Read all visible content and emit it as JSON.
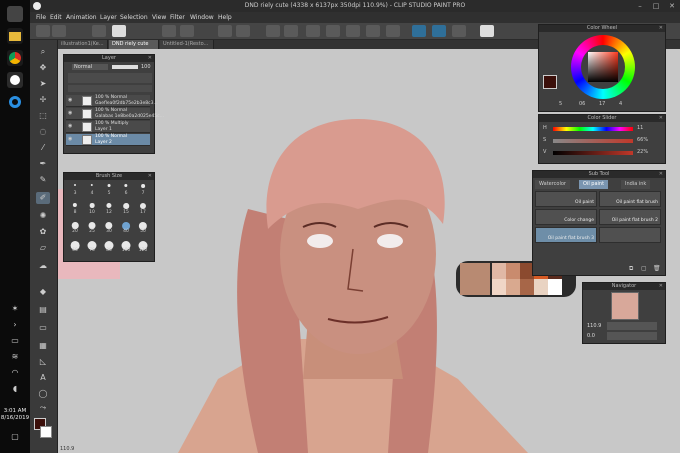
{
  "taskbar": {
    "time": "3:01 AM",
    "date": "8/16/2019"
  },
  "app": {
    "title": "DND riely cute (4338 x 6137px 350dpi 110.9%) - CLIP STUDIO PAINT PRO",
    "menu": [
      "File",
      "Edit",
      "Animation",
      "Layer",
      "Selection",
      "View",
      "Filter",
      "Window",
      "Help"
    ],
    "tabs": [
      "illustration1(Ke...",
      "DND riely cute",
      "Untitled-1(Resto..."
    ]
  },
  "layer_panel": {
    "title": "Layer",
    "blend_mode": "Normal",
    "opacity": "100",
    "layers": [
      {
        "line1": "100 % Normal",
        "line2": "Gaeflea0f2db75e2b3e8c3..."
      },
      {
        "line1": "100 % Normal",
        "line2": "Galabas 1e8be0a2d025e45c..."
      },
      {
        "line1": "100 % Multiply",
        "line2": "Layer 1"
      },
      {
        "line1": "100 % Normal",
        "line2": "Layer 2"
      }
    ]
  },
  "brush_size": {
    "title": "Brush Size",
    "sizes": [
      "3",
      "4",
      "5",
      "6",
      "7",
      "8",
      "10",
      "12",
      "15",
      "17",
      "20",
      "25",
      "30",
      "40",
      "50",
      "60",
      "70",
      "80",
      "100",
      "120"
    ],
    "selected": "40"
  },
  "color_wheel": {
    "title": "Color Wheel",
    "values": [
      "5",
      "06",
      "17",
      "4"
    ],
    "current_color": "#3b0f0a"
  },
  "color_slider": {
    "title": "Color Slider",
    "rows": [
      {
        "label": "H",
        "value": "11"
      },
      {
        "label": "S",
        "value": "66%"
      },
      {
        "label": "V",
        "value": "22%"
      }
    ]
  },
  "sub_tool": {
    "title": "Sub Tool",
    "tabs": [
      "Watercolor",
      "Oil paint",
      "India ink"
    ],
    "active_tab": "Oil paint",
    "items": [
      "Oil paint",
      "Oil paint flat brush",
      "Color change",
      "Oil paint flat brush 2",
      "Oil paint flat brush 3",
      ""
    ]
  },
  "navigator": {
    "title": "Navigator",
    "zoom": "110.9",
    "rotation": "0.0"
  },
  "status": {
    "zoom": "110.9"
  },
  "colors": {
    "accent": "#6b8aa6",
    "panel": "#3f3f3f",
    "canvas": "#c8c8c8",
    "skin": "#c98f7e",
    "hair": "#c77f73"
  }
}
